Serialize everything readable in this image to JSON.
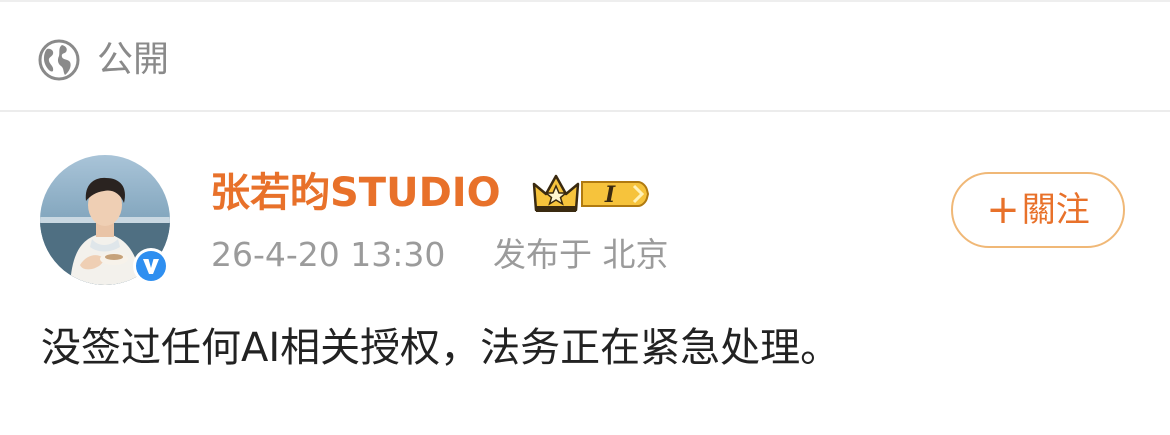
{
  "visibility": {
    "icon": "globe-icon",
    "label": "公開"
  },
  "author": {
    "name": "张若昀STUDIO",
    "avatar_icon": "avatar-photo",
    "verified_icon": "verified-v-icon",
    "membership_badge": {
      "icon": "crown-icon",
      "level_text": "I"
    }
  },
  "meta": {
    "timestamp": "26-4-20 13:30",
    "source": "发布于 北京"
  },
  "follow_button": {
    "plus": "+",
    "label": "關注"
  },
  "post": {
    "text": "没签过任何AI相关授权，法务正在紧急处理。"
  },
  "colors": {
    "username": "#e8712a",
    "follow_border": "#f0b877",
    "muted_text": "#9b9b9b",
    "body_text": "#222222",
    "verified_blue": "#2f8ff0",
    "badge_gold": "#f6c33c"
  }
}
